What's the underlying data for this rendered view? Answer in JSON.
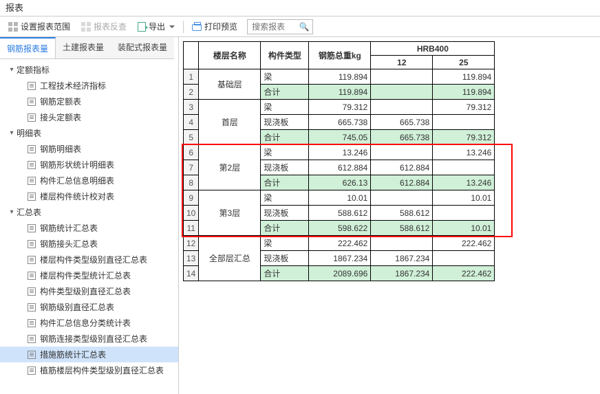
{
  "title": "报表",
  "toolbar": {
    "set_range": "设置报表范围",
    "report_check": "报表反查",
    "export": "导出",
    "print_preview": "打印预览",
    "search_placeholder": "搜索报表"
  },
  "tabs": {
    "a": "钢筋报表量",
    "b": "土建报表量",
    "c": "装配式报表量"
  },
  "tree": {
    "g1": {
      "label": "定额指标",
      "items": [
        "工程技术经济指标",
        "钢筋定额表",
        "接头定额表"
      ]
    },
    "g2": {
      "label": "明细表",
      "items": [
        "钢筋明细表",
        "钢筋形状统计明细表",
        "构件汇总信息明细表",
        "楼层构件统计校对表"
      ]
    },
    "g3": {
      "label": "汇总表",
      "items": [
        "钢筋统计汇总表",
        "钢筋接头汇总表",
        "楼层构件类型级别直径汇总表",
        "楼层构件类型统计汇总表",
        "构件类型级别直径汇总表",
        "钢筋级别直径汇总表",
        "构件汇总信息分类统计表",
        "钢筋连接类型级别直径汇总表",
        "措施筋统计汇总表",
        "植筋楼层构件类型级别直径汇总表"
      ]
    }
  },
  "selected_tree_item": "措施筋统计汇总表",
  "table": {
    "headers": {
      "floor": "楼层名称",
      "type": "构件类型",
      "weight": "钢筋总重kg",
      "hrb": "HRB400",
      "d12": "12",
      "d25": "25"
    },
    "rows": [
      {
        "n": 1,
        "floor": "基础层",
        "rowspan": 2,
        "type": "梁",
        "w": "119.894",
        "d12": "",
        "d25": "119.894"
      },
      {
        "n": 2,
        "type": "合计",
        "w": "119.894",
        "d12": "",
        "d25": "119.894",
        "sub": true
      },
      {
        "n": 3,
        "floor": "首层",
        "rowspan": 3,
        "type": "梁",
        "w": "79.312",
        "d12": "",
        "d25": "79.312"
      },
      {
        "n": 4,
        "type": "现浇板",
        "w": "665.738",
        "d12": "665.738",
        "d25": ""
      },
      {
        "n": 5,
        "type": "合计",
        "w": "745.05",
        "d12": "665.738",
        "d25": "79.312",
        "sub": true
      },
      {
        "n": 6,
        "floor": "第2层",
        "rowspan": 3,
        "type": "梁",
        "w": "13.246",
        "d12": "",
        "d25": "13.246"
      },
      {
        "n": 7,
        "type": "现浇板",
        "w": "612.884",
        "d12": "612.884",
        "d25": ""
      },
      {
        "n": 8,
        "type": "合计",
        "w": "626.13",
        "d12": "612.884",
        "d25": "13.246",
        "sub": true
      },
      {
        "n": 9,
        "floor": "第3层",
        "rowspan": 3,
        "type": "梁",
        "w": "10.01",
        "d12": "",
        "d25": "10.01"
      },
      {
        "n": 10,
        "type": "现浇板",
        "w": "588.612",
        "d12": "588.612",
        "d25": ""
      },
      {
        "n": 11,
        "type": "合计",
        "w": "598.622",
        "d12": "588.612",
        "d25": "10.01",
        "sub": true
      },
      {
        "n": 12,
        "floor": "全部层汇总",
        "rowspan": 3,
        "type": "梁",
        "w": "222.462",
        "d12": "",
        "d25": "222.462"
      },
      {
        "n": 13,
        "type": "现浇板",
        "w": "1867.234",
        "d12": "1867.234",
        "d25": ""
      },
      {
        "n": 14,
        "type": "合计",
        "w": "2089.696",
        "d12": "1867.234",
        "d25": "222.462",
        "sub": true
      }
    ]
  }
}
